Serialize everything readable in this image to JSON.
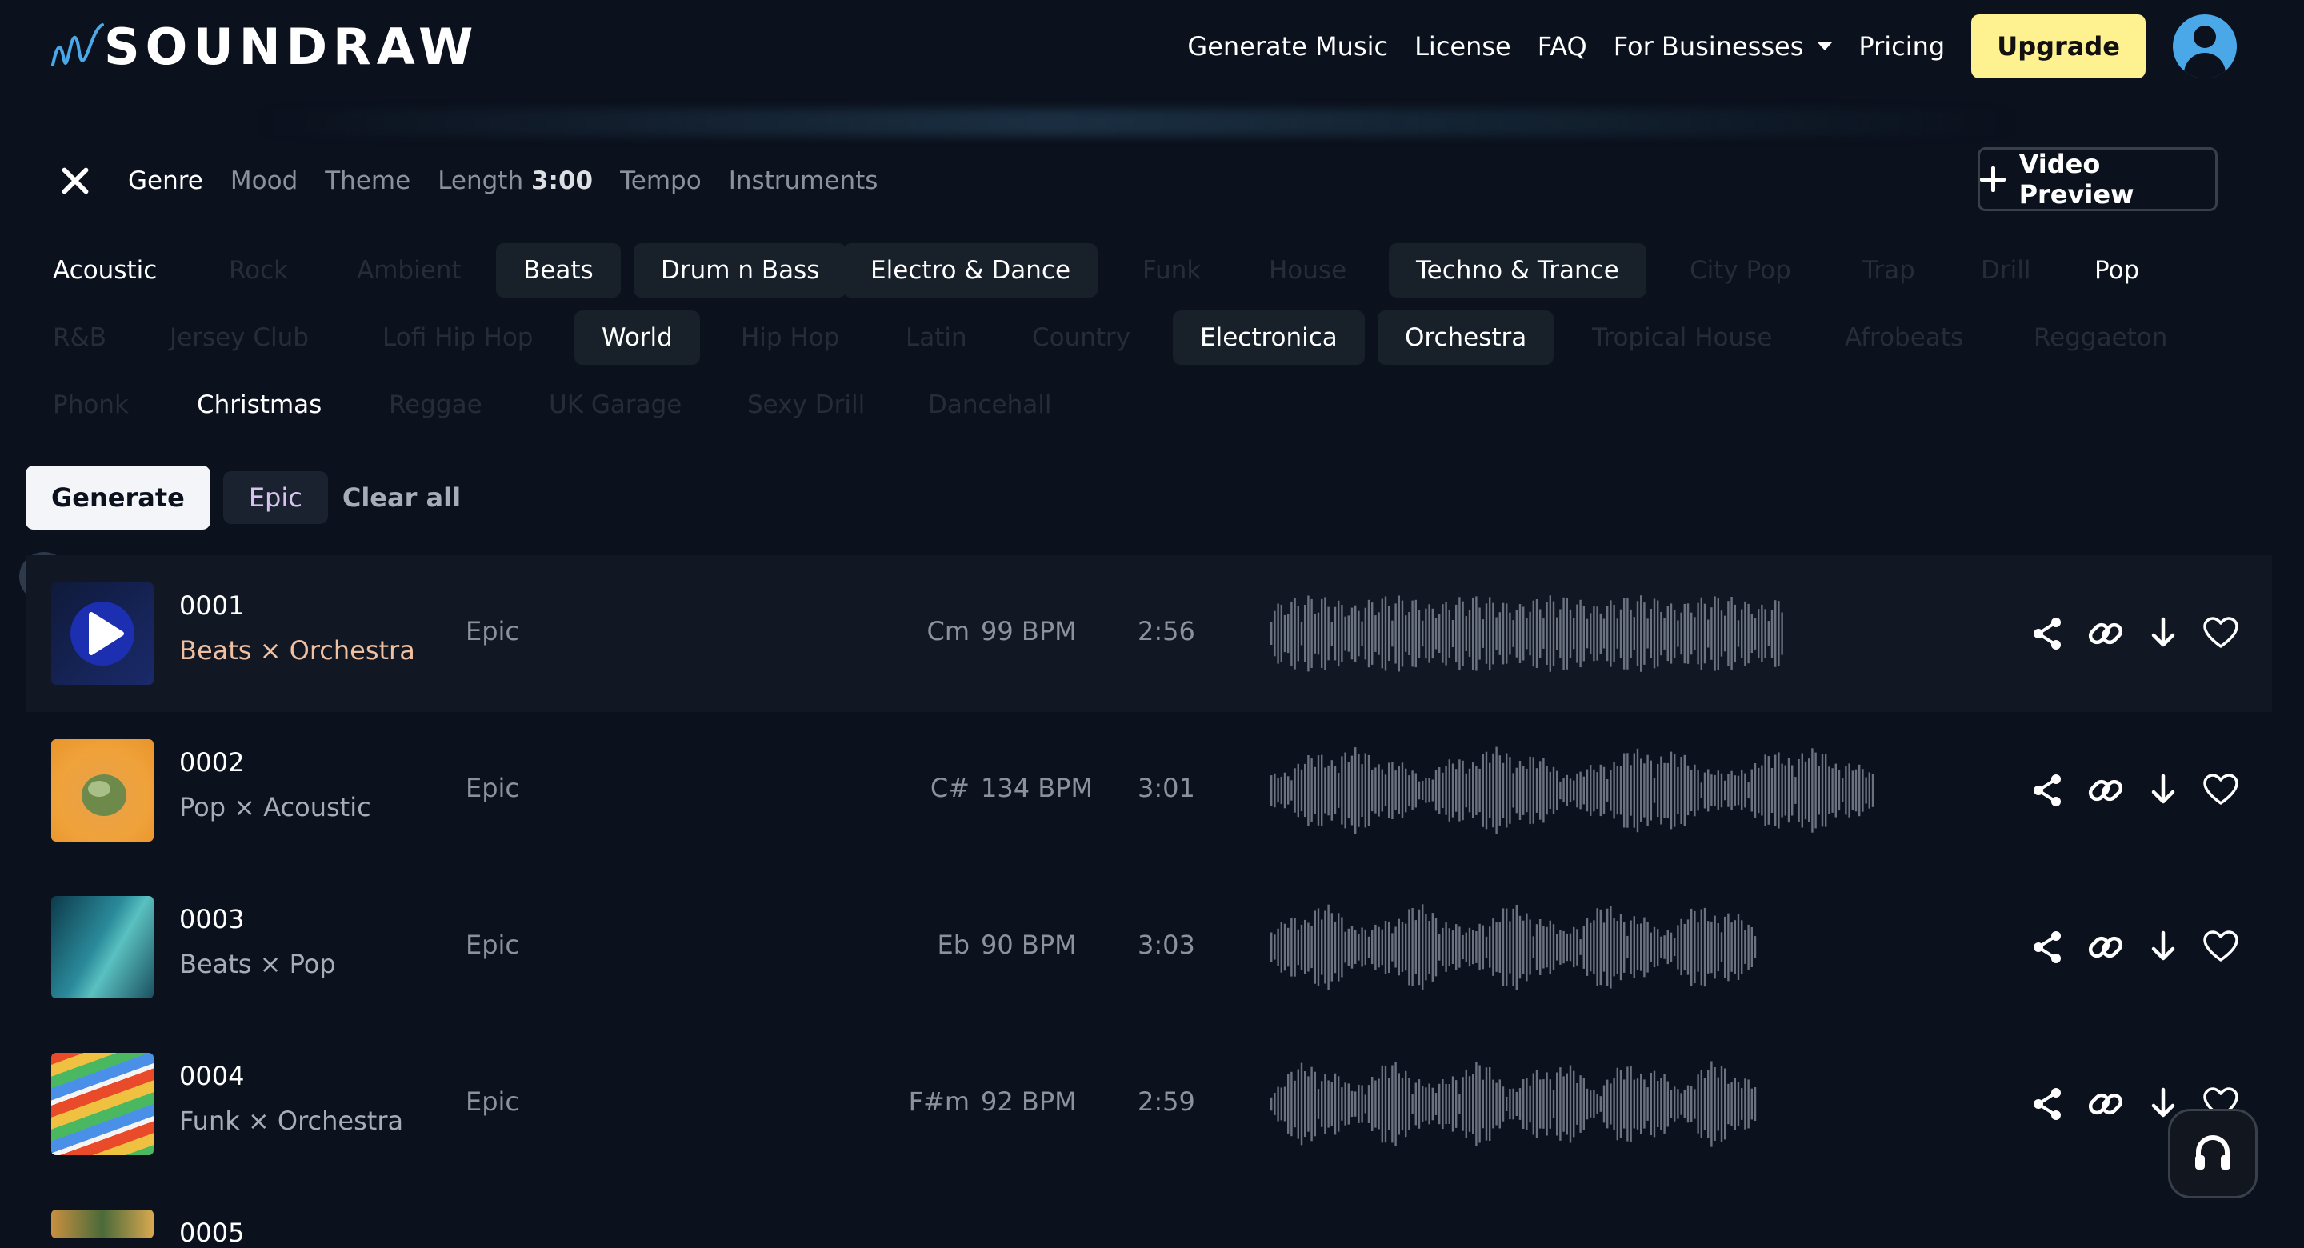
{
  "header": {
    "brand": "SOUNDRAW",
    "nav": [
      "Generate Music",
      "License",
      "FAQ",
      "For Businesses",
      "Pricing"
    ],
    "upgrade_label": "Upgrade"
  },
  "filters": {
    "tabs": [
      "Genre",
      "Mood",
      "Theme",
      "Length",
      "Tempo",
      "Instruments"
    ],
    "length_value": "3:00",
    "video_preview_label": "Video Preview"
  },
  "genres": [
    {
      "label": "Acoustic",
      "state": "plain"
    },
    {
      "label": "Rock",
      "state": "off"
    },
    {
      "label": "Ambient",
      "state": "off"
    },
    {
      "label": "Beats",
      "state": "on"
    },
    {
      "label": "Drum n Bass",
      "state": "on"
    },
    {
      "label": "Electro & Dance",
      "state": "on"
    },
    {
      "label": "Funk",
      "state": "off"
    },
    {
      "label": "House",
      "state": "off"
    },
    {
      "label": "Techno & Trance",
      "state": "on"
    },
    {
      "label": "City Pop",
      "state": "off"
    },
    {
      "label": "Trap",
      "state": "off"
    },
    {
      "label": "Drill",
      "state": "off"
    },
    {
      "label": "Pop",
      "state": "plain"
    },
    {
      "label": "R&B",
      "state": "off"
    },
    {
      "label": "Jersey Club",
      "state": "off"
    },
    {
      "label": "Lofi Hip Hop",
      "state": "off"
    },
    {
      "label": "World",
      "state": "on"
    },
    {
      "label": "Hip Hop",
      "state": "off"
    },
    {
      "label": "Latin",
      "state": "off"
    },
    {
      "label": "Country",
      "state": "off"
    },
    {
      "label": "Electronica",
      "state": "on"
    },
    {
      "label": "Orchestra",
      "state": "on"
    },
    {
      "label": "Tropical House",
      "state": "off"
    },
    {
      "label": "Afrobeats",
      "state": "off"
    },
    {
      "label": "Reggaeton",
      "state": "off"
    },
    {
      "label": "Phonk",
      "state": "off"
    },
    {
      "label": "Christmas",
      "state": "plain"
    },
    {
      "label": "Reggae",
      "state": "off"
    },
    {
      "label": "UK Garage",
      "state": "off"
    },
    {
      "label": "Sexy Drill",
      "state": "off"
    },
    {
      "label": "Dancehall",
      "state": "off"
    }
  ],
  "actions": {
    "generate_label": "Generate",
    "selected_chip": "Epic",
    "clear_label": "Clear all"
  },
  "tracks": [
    {
      "num": "0001",
      "genres": "Beats × Orchestra",
      "mood": "Epic",
      "key": "Cm",
      "bpm": "99 BPM",
      "length": "2:56",
      "thumb": "play"
    },
    {
      "num": "0002",
      "genres": "Pop × Acoustic",
      "mood": "Epic",
      "key": "C#",
      "bpm": "134 BPM",
      "length": "3:01",
      "thumb": "orange"
    },
    {
      "num": "0003",
      "genres": "Beats × Pop",
      "mood": "Epic",
      "key": "Eb",
      "bpm": "90 BPM",
      "length": "3:03",
      "thumb": "teal"
    },
    {
      "num": "0004",
      "genres": "Funk × Orchestra",
      "mood": "Epic",
      "key": "F#m",
      "bpm": "92 BPM",
      "length": "2:59",
      "thumb": "stripes"
    },
    {
      "num": "0005",
      "genres": "",
      "mood": "",
      "key": "",
      "bpm": "",
      "length": "",
      "thumb": "palm"
    }
  ],
  "colors": {
    "background": "#0b111d",
    "accent_yellow": "#fdf28f",
    "avatar_blue": "#4aa8e8"
  },
  "icons": [
    "share-icon",
    "link-icon",
    "download-icon",
    "heart-icon",
    "headset-icon",
    "close-icon",
    "plus-icon",
    "chevron-down-icon"
  ]
}
